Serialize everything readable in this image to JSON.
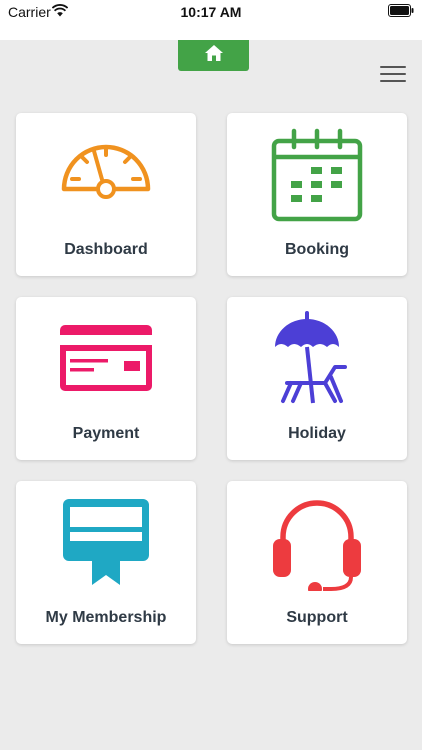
{
  "status_bar": {
    "carrier": "Carrier",
    "time": "10:17 AM"
  },
  "header": {
    "home_icon": "home-icon",
    "menu_icon": "hamburger-menu-icon"
  },
  "tiles": [
    {
      "label": "Dashboard",
      "icon": "speedometer-icon",
      "color": "#f0921f"
    },
    {
      "label": "Booking",
      "icon": "calendar-icon",
      "color": "#43a347"
    },
    {
      "label": "Payment",
      "icon": "credit-card-icon",
      "color": "#ec1a68"
    },
    {
      "label": "Holiday",
      "icon": "beach-umbrella-icon",
      "color": "#4c3fd6"
    },
    {
      "label": "My Membership",
      "icon": "membership-card-icon",
      "color": "#1fa8c4"
    },
    {
      "label": "Support",
      "icon": "headset-icon",
      "color": "#ed3b3f"
    }
  ],
  "colors": {
    "accent": "#43a347",
    "background": "#ebebeb",
    "tile_label": "#2f3a45"
  }
}
